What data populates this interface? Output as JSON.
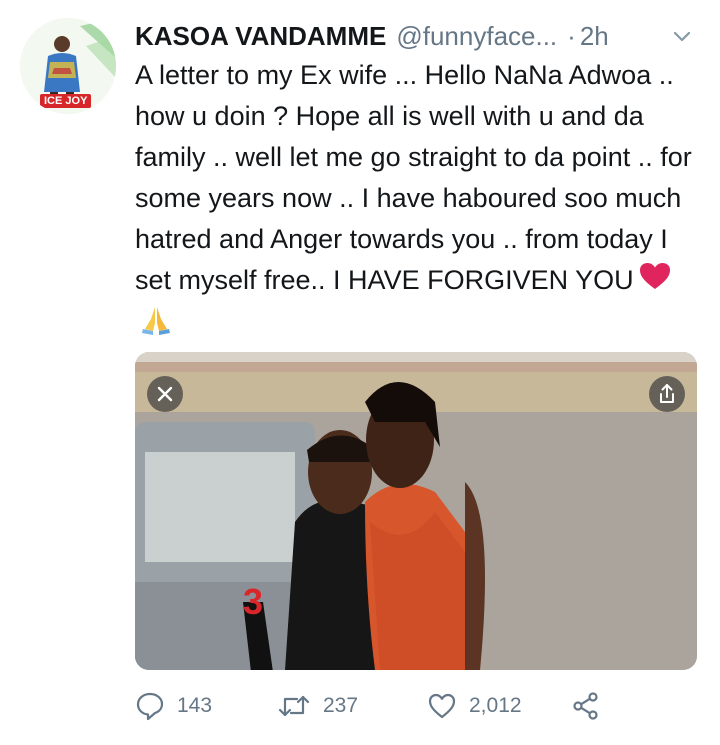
{
  "tweet": {
    "display_name": "KASOA VANDAMME",
    "handle": "@funnyface...",
    "separator": "·",
    "time": "2h",
    "avatar_badge": "ICE JOY",
    "text": "A letter to my Ex wife ... Hello NaNa Adwoa .. how u doin ? Hope all is well with u and da family .. well let me go straight to da point .. for some years now .. I have haboured soo much hatred and Anger towards you .. from today I set myself free.. I HAVE FORGIVEN YOU",
    "emojis": [
      "red-heart",
      "folded-hands"
    ]
  },
  "actions": {
    "replies": "143",
    "retweets": "237",
    "likes": "2,012"
  },
  "colors": {
    "text": "#14171a",
    "secondary": "#657786",
    "heart": "#e0245e"
  }
}
